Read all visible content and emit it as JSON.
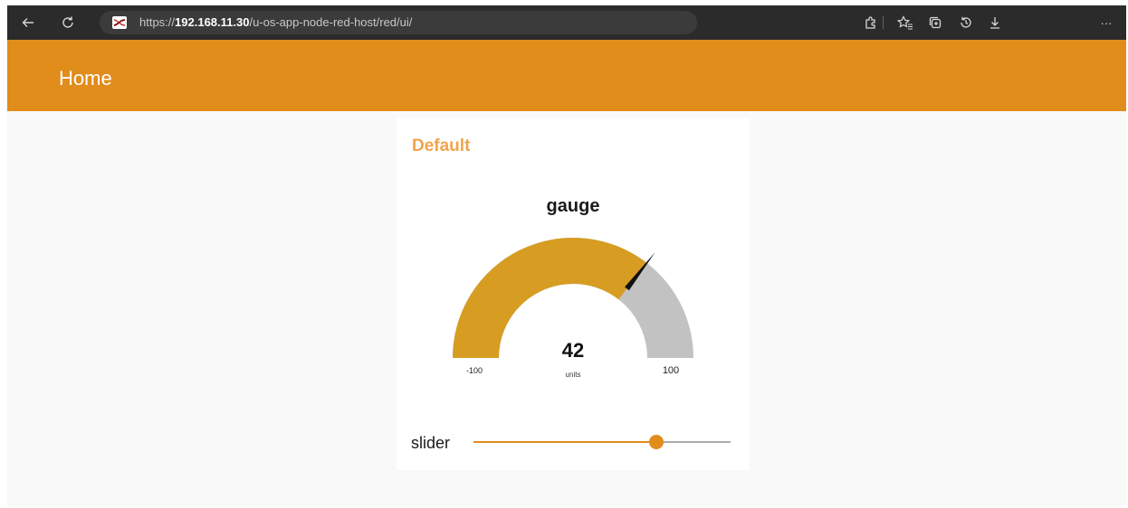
{
  "browser": {
    "url_prefix": "https://",
    "url_host": "192.168.11.30",
    "url_path": "/u-os-app-node-red-host/red/ui/",
    "more_label": "···"
  },
  "header": {
    "title": "Home"
  },
  "group": {
    "title": "Default"
  },
  "gauge": {
    "title": "gauge",
    "value": 42,
    "value_text": "42",
    "units": "units",
    "min": -100,
    "max": 100,
    "min_label": "-100",
    "max_label": "100",
    "fill_color": "#d69d22",
    "track_color": "#c2c2c2",
    "needle_color": "#111111"
  },
  "slider": {
    "label": "slider",
    "value": 0.71
  },
  "colors": {
    "accent": "#e18d1b",
    "group_title": "#f2a34a"
  }
}
